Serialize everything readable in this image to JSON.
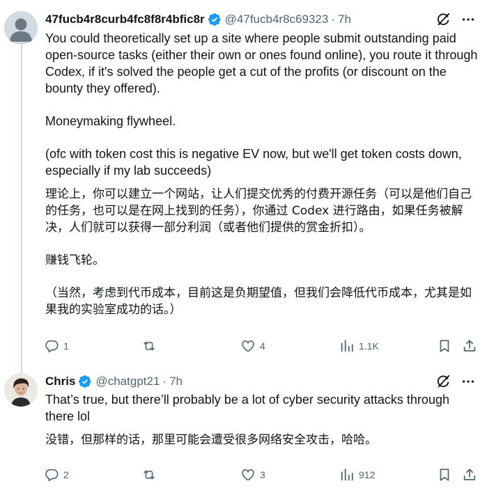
{
  "tweets": [
    {
      "author": "47fucb4r8curb4fc8f8r4bfic8r",
      "handle": "@47fucb4r8c69323",
      "separator": "·",
      "time": "7h",
      "paragraphs_en": [
        "You could theoretically set up a site where people submit outstanding paid open-source tasks (either their own or ones found online), you route it through Codex, if it's solved the people get a cut of the profits (or discount on the bounty they offered).",
        "Moneymaking flywheel.",
        "(ofc with token cost this is negative EV now, but we'll get token costs down, especially if my lab succeeds)"
      ],
      "paragraphs_zh": [
        "理论上，你可以建立一个网站，让人们提交优秀的付费开源任务（可以是他们自己的任务，也可以是在网上找到的任务），你通过 Codex 进行路由，如果任务被解决，人们就可以获得一部分利润（或者他们提供的赏金折扣）。",
        "赚钱飞轮。",
        "（当然，考虑到代币成本，目前这是负期望值，但我们会降低代币成本，尤其是如果我的实验室成功的话。）"
      ],
      "stats": {
        "replies": "1",
        "retweets": "",
        "likes": "4",
        "views": "1.1K"
      }
    },
    {
      "author": "Chris",
      "handle": "@chatgpt21",
      "separator": "·",
      "time": "7h",
      "paragraphs_en": [
        "That’s true, but there’ll probably be a lot of cyber security attacks through there lol"
      ],
      "paragraphs_zh": [
        "没错，但那样的话，那里可能会遭受很多网络安全攻击，哈哈。"
      ],
      "stats": {
        "replies": "2",
        "retweets": "",
        "likes": "3",
        "views": "912"
      }
    }
  ],
  "colors": {
    "text": "#0f1419",
    "secondary": "#536471",
    "verified_blue": "#1d9bf0",
    "thread_line": "#cfd9de"
  },
  "icons": [
    "verified-badge-icon",
    "grok-icon",
    "more-icon",
    "reply-icon",
    "retweet-icon",
    "like-icon",
    "views-icon",
    "bookmark-icon",
    "share-icon"
  ]
}
